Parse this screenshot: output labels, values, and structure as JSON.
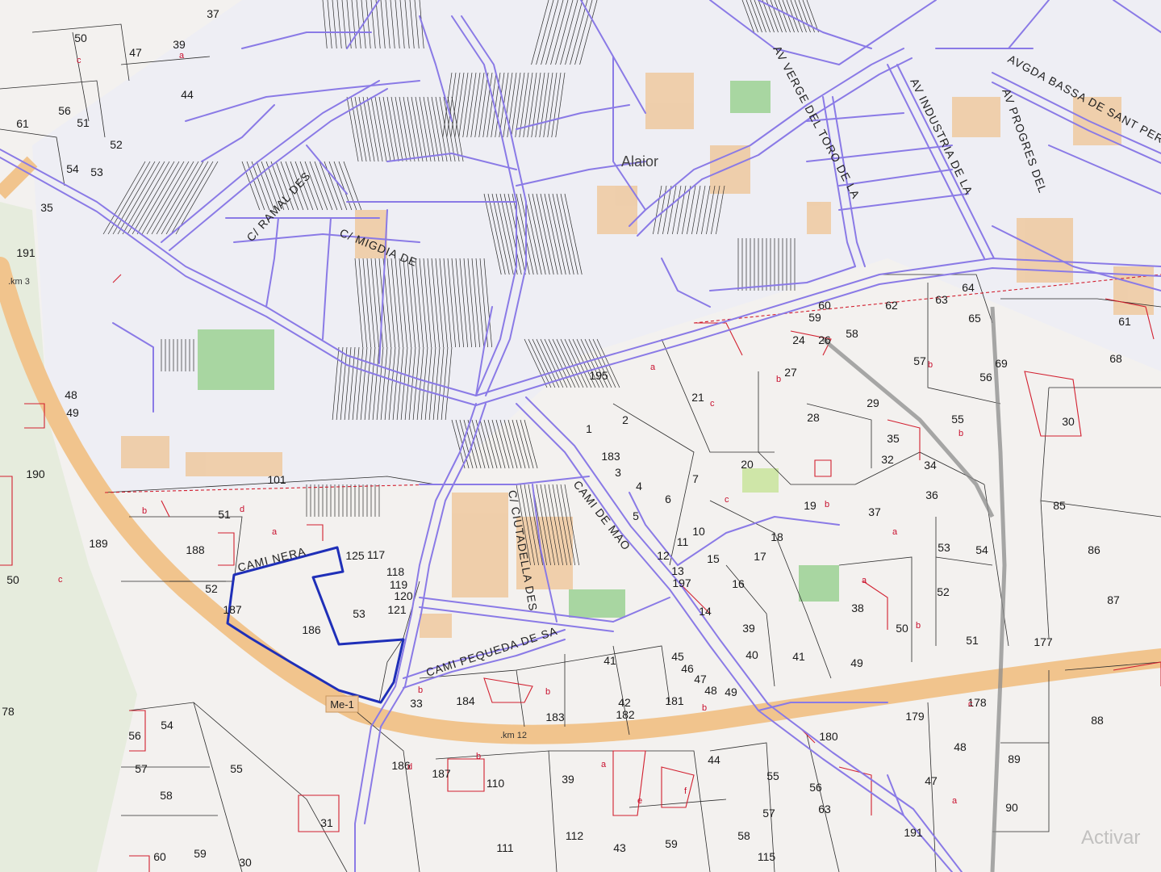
{
  "map": {
    "town": "Alaior",
    "road_shield": "Me-1",
    "km_markers": [
      ".km 3",
      ".km 12"
    ],
    "watermark": "Activar",
    "colors": {
      "background": "#f2f0ee",
      "street_lines": "#8a7ae6",
      "parcel_lines": "#2b2b2b",
      "sub_parcels": "#d21f2f",
      "highway": "#f2c58f",
      "buildings": "#f0c9a0",
      "green_areas": "#a9d7a2",
      "highlight_boundary": "#1f2fb8",
      "vegetation_left": "#d8e8cf"
    },
    "streets": [
      {
        "id": "ramal",
        "text": "C/ RAMAL DES"
      },
      {
        "id": "migdia",
        "text": "C/ MIGDIA DE"
      },
      {
        "id": "toro",
        "text": "AV VERGE DEL TORO DE LA"
      },
      {
        "id": "industria",
        "text": "AV INDUSTRIA DE LA"
      },
      {
        "id": "bassa",
        "text": "AVGDA BASSA DE SANT PERE"
      },
      {
        "id": "progres",
        "text": "AV PROGRES DEL"
      },
      {
        "id": "calmerca",
        "text": "CAMI NERA"
      },
      {
        "id": "calmerca2",
        "text": "CAMI DE MAO"
      },
      {
        "id": "ciutadella",
        "text": "C/ CIUTADELLA DES"
      },
      {
        "id": "pequeda",
        "text": "CAMI PEQUEDA DE SA"
      }
    ],
    "parcels": [
      {
        "id": "p37",
        "label": "37"
      },
      {
        "id": "p50a",
        "label": "50"
      },
      {
        "id": "p47",
        "label": "47"
      },
      {
        "id": "p39a",
        "label": "39"
      },
      {
        "id": "p44",
        "label": "44"
      },
      {
        "id": "p61",
        "label": "61"
      },
      {
        "id": "p51a",
        "label": "51"
      },
      {
        "id": "p56a",
        "label": "56"
      },
      {
        "id": "p54a",
        "label": "54"
      },
      {
        "id": "p53a",
        "label": "53"
      },
      {
        "id": "p52a",
        "label": "52"
      },
      {
        "id": "p35a",
        "label": "35"
      },
      {
        "id": "p191",
        "label": "191"
      },
      {
        "id": "p48a",
        "label": "48"
      },
      {
        "id": "p49a",
        "label": "49"
      },
      {
        "id": "p190",
        "label": "190"
      },
      {
        "id": "p189",
        "label": "189"
      },
      {
        "id": "p50b",
        "label": "50"
      },
      {
        "id": "p188",
        "label": "188"
      },
      {
        "id": "p51b",
        "label": "51"
      },
      {
        "id": "p52b",
        "label": "52"
      },
      {
        "id": "p187",
        "label": "187"
      },
      {
        "id": "p186a",
        "label": "186"
      },
      {
        "id": "p53b",
        "label": "53"
      },
      {
        "id": "p101",
        "label": "101"
      },
      {
        "id": "p118",
        "label": "118"
      },
      {
        "id": "p119",
        "label": "119"
      },
      {
        "id": "p120",
        "label": "120"
      },
      {
        "id": "p121",
        "label": "121"
      },
      {
        "id": "p125",
        "label": "125"
      },
      {
        "id": "p117",
        "label": "117"
      },
      {
        "id": "p78",
        "label": "78"
      },
      {
        "id": "p54b",
        "label": "54"
      },
      {
        "id": "p56b",
        "label": "56"
      },
      {
        "id": "p57a",
        "label": "57"
      },
      {
        "id": "p55a",
        "label": "55"
      },
      {
        "id": "p58a",
        "label": "58"
      },
      {
        "id": "p31",
        "label": "31"
      },
      {
        "id": "p30",
        "label": "30"
      },
      {
        "id": "p59a",
        "label": "59"
      },
      {
        "id": "p60",
        "label": "60"
      },
      {
        "id": "p33",
        "label": "33"
      },
      {
        "id": "p184",
        "label": "184"
      },
      {
        "id": "p186b",
        "label": "186"
      },
      {
        "id": "p187b",
        "label": "187"
      },
      {
        "id": "p110",
        "label": "110"
      },
      {
        "id": "p39b",
        "label": "39"
      },
      {
        "id": "p183",
        "label": "183"
      },
      {
        "id": "p182",
        "label": "182"
      },
      {
        "id": "p42",
        "label": "42"
      },
      {
        "id": "p41a",
        "label": "41"
      },
      {
        "id": "p44b",
        "label": "44"
      },
      {
        "id": "p112",
        "label": "112"
      },
      {
        "id": "p111",
        "label": "111"
      },
      {
        "id": "p43",
        "label": "43"
      },
      {
        "id": "p59b",
        "label": "59"
      },
      {
        "id": "p58b",
        "label": "58"
      },
      {
        "id": "p57b",
        "label": "57"
      },
      {
        "id": "p55b",
        "label": "55"
      },
      {
        "id": "p56c",
        "label": "56"
      },
      {
        "id": "p63a",
        "label": "63"
      },
      {
        "id": "p191b",
        "label": "191"
      },
      {
        "id": "p47b",
        "label": "47"
      },
      {
        "id": "p179",
        "label": "179"
      },
      {
        "id": "p178",
        "label": "178"
      },
      {
        "id": "p48b",
        "label": "48"
      },
      {
        "id": "p88",
        "label": "88"
      },
      {
        "id": "p89",
        "label": "89"
      },
      {
        "id": "p90",
        "label": "90"
      },
      {
        "id": "p180",
        "label": "180"
      },
      {
        "id": "p181",
        "label": "181"
      },
      {
        "id": "p48c",
        "label": "48"
      },
      {
        "id": "p49b",
        "label": "49"
      },
      {
        "id": "p47c",
        "label": "47"
      },
      {
        "id": "p46",
        "label": "46"
      },
      {
        "id": "p45",
        "label": "45"
      },
      {
        "id": "p40",
        "label": "40"
      },
      {
        "id": "p39c",
        "label": "39"
      },
      {
        "id": "p41b",
        "label": "41"
      },
      {
        "id": "p14",
        "label": "14"
      },
      {
        "id": "p16",
        "label": "16"
      },
      {
        "id": "p17",
        "label": "17"
      },
      {
        "id": "p18",
        "label": "18"
      },
      {
        "id": "p15",
        "label": "15"
      },
      {
        "id": "p12",
        "label": "12"
      },
      {
        "id": "p11",
        "label": "11"
      },
      {
        "id": "p10",
        "label": "10"
      },
      {
        "id": "p13",
        "label": "13"
      },
      {
        "id": "p197",
        "label": "197"
      },
      {
        "id": "p6",
        "label": "6"
      },
      {
        "id": "p5",
        "label": "5"
      },
      {
        "id": "p4",
        "label": "4"
      },
      {
        "id": "p7",
        "label": "7"
      },
      {
        "id": "p3",
        "label": "3"
      },
      {
        "id": "p2",
        "label": "2"
      },
      {
        "id": "p1",
        "label": "1"
      },
      {
        "id": "p183b",
        "label": "183"
      },
      {
        "id": "p195",
        "label": "195"
      },
      {
        "id": "p21",
        "label": "21"
      },
      {
        "id": "p20",
        "label": "20"
      },
      {
        "id": "p19",
        "label": "19"
      },
      {
        "id": "p27",
        "label": "27"
      },
      {
        "id": "p28",
        "label": "28"
      },
      {
        "id": "p37b",
        "label": "37"
      },
      {
        "id": "p36",
        "label": "36"
      },
      {
        "id": "p32",
        "label": "32"
      },
      {
        "id": "p34",
        "label": "34"
      },
      {
        "id": "p35b",
        "label": "35"
      },
      {
        "id": "p53c",
        "label": "53"
      },
      {
        "id": "p54c",
        "label": "54"
      },
      {
        "id": "p52c",
        "label": "52"
      },
      {
        "id": "p51c",
        "label": "51"
      },
      {
        "id": "p50c",
        "label": "50"
      },
      {
        "id": "p38",
        "label": "38"
      },
      {
        "id": "p49c",
        "label": "49"
      },
      {
        "id": "p177",
        "label": "177"
      },
      {
        "id": "p87",
        "label": "87"
      },
      {
        "id": "p86",
        "label": "86"
      },
      {
        "id": "p85",
        "label": "85"
      },
      {
        "id": "p55c",
        "label": "55"
      },
      {
        "id": "p57c",
        "label": "57"
      },
      {
        "id": "p56d",
        "label": "56"
      },
      {
        "id": "p29",
        "label": "29"
      },
      {
        "id": "p30b",
        "label": "30"
      },
      {
        "id": "p59c",
        "label": "59"
      },
      {
        "id": "p60b",
        "label": "60"
      },
      {
        "id": "p62",
        "label": "62"
      },
      {
        "id": "p63b",
        "label": "63"
      },
      {
        "id": "p64",
        "label": "64"
      },
      {
        "id": "p65",
        "label": "65"
      },
      {
        "id": "p68",
        "label": "68"
      },
      {
        "id": "p69",
        "label": "69"
      },
      {
        "id": "p61b",
        "label": "61"
      },
      {
        "id": "p58c",
        "label": "58"
      },
      {
        "id": "p24",
        "label": "24"
      },
      {
        "id": "p26",
        "label": "26"
      },
      {
        "id": "p115",
        "label": "115"
      }
    ]
  }
}
